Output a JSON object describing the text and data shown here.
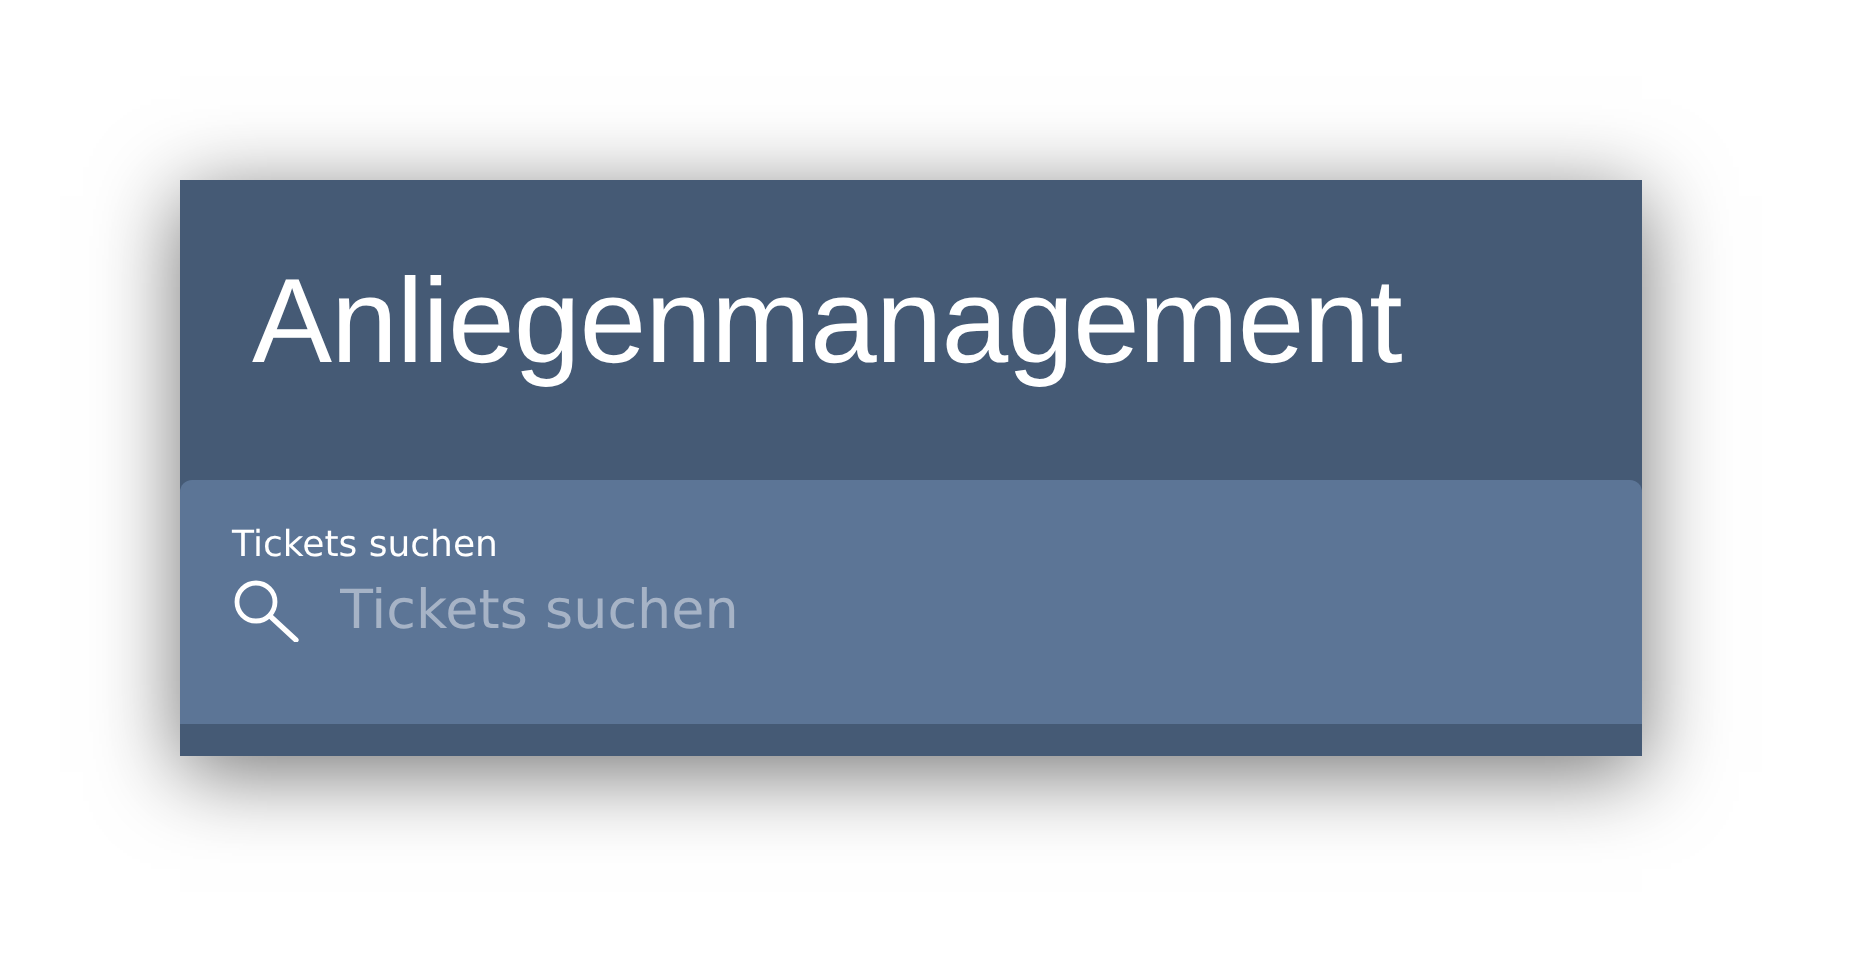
{
  "header": {
    "title": "Anliegenmanagement"
  },
  "search": {
    "label": "Tickets suchen",
    "placeholder": "Tickets suchen"
  }
}
